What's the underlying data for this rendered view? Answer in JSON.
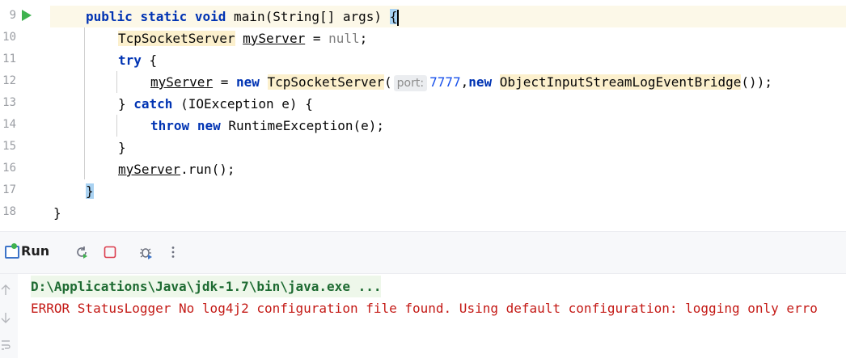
{
  "editor": {
    "line_numbers": [
      "9",
      "10",
      "11",
      "12",
      "13",
      "14",
      "15",
      "16",
      "17",
      "18"
    ],
    "lines": {
      "l9": {
        "kw1": "public",
        "kw2": "static",
        "kw3": "void",
        "rest": " main(String[] args) ",
        "brace": "{"
      },
      "l10": {
        "type": "TcpSocketServer",
        "var": "myServer",
        "eq": " = ",
        "nul": "null",
        "end": ";"
      },
      "l11": {
        "kw": "try",
        "rest": " {"
      },
      "l12": {
        "var": "myServer",
        "eq": " = ",
        "kw": "new",
        "sp": " ",
        "type": "TcpSocketServer",
        "paren": "(",
        "hint": "port:",
        "num": "7777",
        "comma": ",",
        "kw2": "new",
        "sp2": " ",
        "type2": "ObjectInputStreamLogEventBridge",
        "end": "());"
      },
      "l13": {
        "pre": "} ",
        "kw": "catch",
        "rest": " (IOException e) {"
      },
      "l14": {
        "kw": "throw",
        "sp": " ",
        "kw2": "new",
        "rest": " RuntimeException(e);"
      },
      "l15": {
        "text": "}"
      },
      "l16": {
        "var": "myServer",
        "rest": ".run();"
      },
      "l17": {
        "brace": "}"
      },
      "l18": {
        "text": "}"
      }
    }
  },
  "run_panel": {
    "tab_label": "Run",
    "icons": [
      "rerun-icon",
      "stop-icon",
      "debug-icon",
      "more-icon"
    ]
  },
  "console": {
    "lines": [
      "D:\\Applications\\Java\\jdk-1.7\\bin\\java.exe ...",
      "ERROR StatusLogger No log4j2 configuration file found. Using default configuration: logging only erro"
    ]
  },
  "colors": {
    "keyword": "#0033b3",
    "number": "#1750eb",
    "error_text": "#c41a16",
    "run_green": "#3fb24f"
  }
}
